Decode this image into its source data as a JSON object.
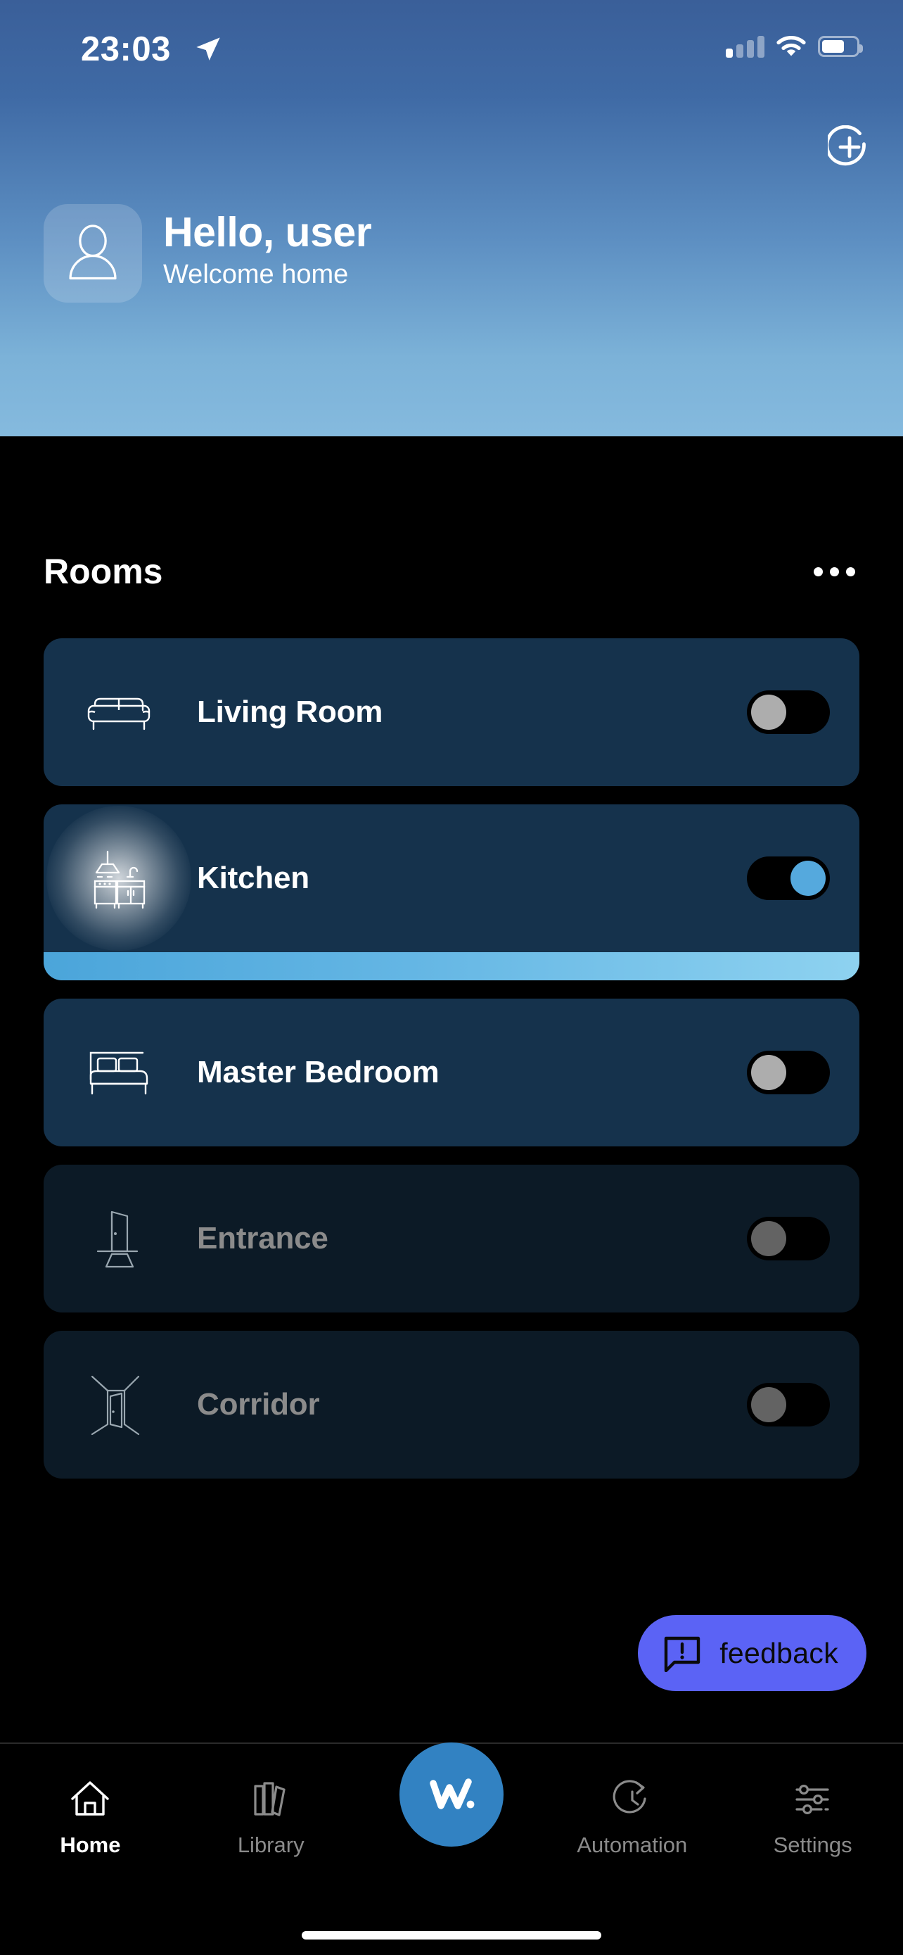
{
  "status_bar": {
    "time": "23:03",
    "location_icon": "location-arrow-icon",
    "signal_icon": "cellular-signal-icon",
    "signal_bars_filled": 1,
    "wifi_icon": "wifi-icon",
    "battery_icon": "battery-icon",
    "battery_percent": 65
  },
  "header": {
    "add_button_icon": "add-circle-icon",
    "avatar_icon": "person-icon",
    "greeting_title": "Hello, user",
    "greeting_subtitle": "Welcome home",
    "gradient_top": "#3a5f99",
    "gradient_bottom": "#85bade"
  },
  "rooms_section": {
    "title": "Rooms",
    "more_icon": "more-horizontal-icon",
    "rooms": [
      {
        "name": "Living Room",
        "icon": "sofa-icon",
        "state": "off",
        "enabled": true,
        "toggle_on": false,
        "brightness_visible": false,
        "card_color": "#15324c",
        "label_color": "#ffffff"
      },
      {
        "name": "Kitchen",
        "icon": "kitchen-counter-icon",
        "state": "on",
        "enabled": true,
        "toggle_on": true,
        "brightness_visible": true,
        "brightness_gradient_start": "#4ba5da",
        "brightness_gradient_end": "#8ed2f0",
        "card_color": "#15324c",
        "label_color": "#ffffff"
      },
      {
        "name": "Master Bedroom",
        "icon": "bed-icon",
        "state": "off",
        "enabled": true,
        "toggle_on": false,
        "brightness_visible": false,
        "card_color": "#15324c",
        "label_color": "#ffffff"
      },
      {
        "name": "Entrance",
        "icon": "door-entrance-icon",
        "state": "unavailable",
        "enabled": false,
        "toggle_on": false,
        "brightness_visible": false,
        "card_color": "#0c1a26",
        "label_color": "#8b8b8b"
      },
      {
        "name": "Corridor",
        "icon": "corridor-icon",
        "state": "unavailable",
        "enabled": false,
        "toggle_on": false,
        "brightness_visible": false,
        "card_color": "#0c1a26",
        "label_color": "#8b8b8b"
      }
    ]
  },
  "feedback_button": {
    "label": "feedback",
    "icon": "feedback-message-icon",
    "color": "#5b63f5",
    "text_color": "#0a0a0a"
  },
  "bottom_nav": {
    "accent_color": "#3282c2",
    "logo_text": "w.",
    "logo_icon": "brand-w-logo",
    "items": [
      {
        "label": "Home",
        "icon": "home-icon",
        "active": true
      },
      {
        "label": "Library",
        "icon": "library-books-icon",
        "active": false
      },
      {
        "label": "",
        "icon": "brand-w-logo",
        "active": false
      },
      {
        "label": "Automation",
        "icon": "automation-refresh-clock-icon",
        "active": false
      },
      {
        "label": "Settings",
        "icon": "settings-sliders-icon",
        "active": false
      }
    ]
  },
  "home_indicator": {
    "icon": "home-indicator-bar"
  }
}
